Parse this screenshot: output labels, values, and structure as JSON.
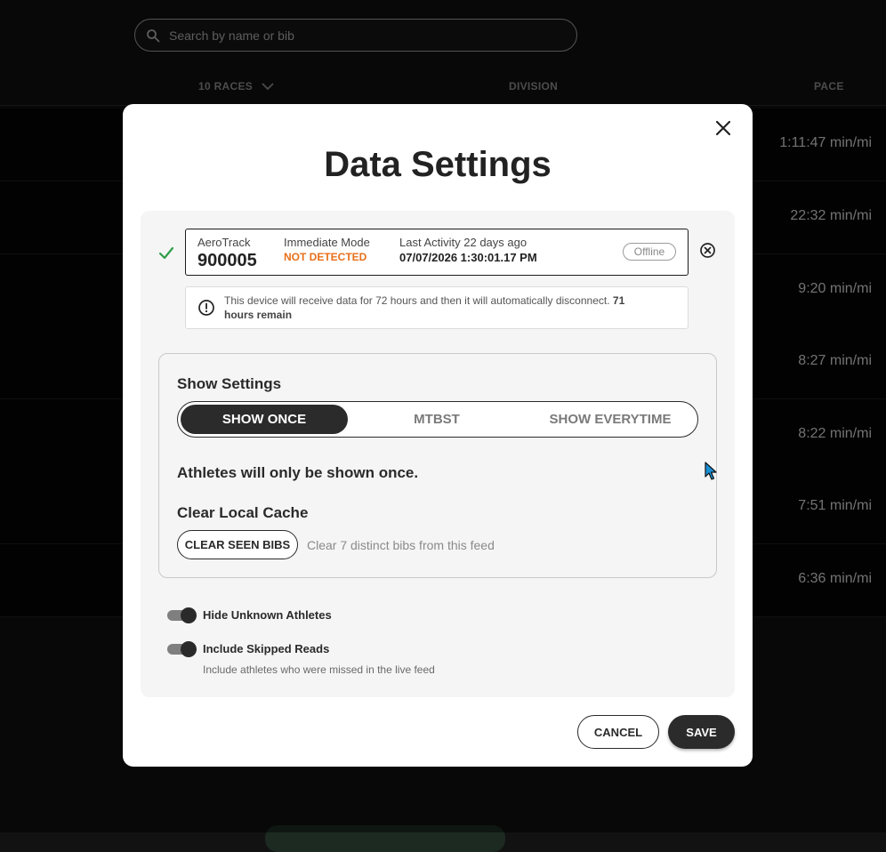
{
  "background": {
    "search": {
      "placeholder": "Search by name or bib"
    },
    "headers": {
      "races": "10 RACES",
      "division": "DIVISION",
      "pace": "PACE"
    },
    "rows": [
      {
        "pace": "1:11:47 min/mi"
      },
      {
        "pace": "22:32 min/mi"
      },
      {
        "pace": "9:20 min/mi"
      },
      {
        "pace": "8:27 min/mi"
      },
      {
        "pace": "8:22 min/mi"
      },
      {
        "pace": "7:51 min/mi"
      },
      {
        "pace": "6:36 min/mi"
      }
    ]
  },
  "modal": {
    "title": "Data Settings",
    "device": {
      "name": "AeroTrack",
      "id": "900005",
      "mode_label": "Immediate Mode",
      "mode_status": "NOT DETECTED",
      "activity_label": "Last Activity 22 days ago",
      "activity_time": "07/07/2026 1:30:01.17 PM",
      "status": "Offline"
    },
    "notice": {
      "text": "This device will receive data for 72 hours and then it will automatically disconnect.",
      "remaining": "71 hours remain"
    },
    "show_settings": {
      "title": "Show Settings",
      "options": [
        "SHOW ONCE",
        "MTBST",
        "SHOW EVERYTIME"
      ],
      "selected": "SHOW ONCE",
      "description": "Athletes will only be shown once."
    },
    "cache": {
      "title": "Clear Local Cache",
      "button": "CLEAR SEEN BIBS",
      "note": "Clear 7 distinct bibs from this feed"
    },
    "toggles": {
      "hide_unknown": {
        "label": "Hide Unknown Athletes",
        "on": true
      },
      "include_skipped": {
        "label": "Include Skipped Reads",
        "sub": "Include athletes who were missed in the live feed",
        "on": true
      }
    },
    "actions": {
      "cancel": "CANCEL",
      "save": "SAVE"
    }
  },
  "colors": {
    "accent_dark": "#2b2b2b",
    "warning": "#e8701a",
    "success_check": "#2e9e4a",
    "cursor": "#1a8fd6"
  },
  "icons": {
    "search": "search-icon",
    "chevron": "chevron-down-icon",
    "close": "close-icon",
    "check": "check-icon",
    "remove": "circle-x-icon",
    "info": "exclamation-circle-icon"
  }
}
